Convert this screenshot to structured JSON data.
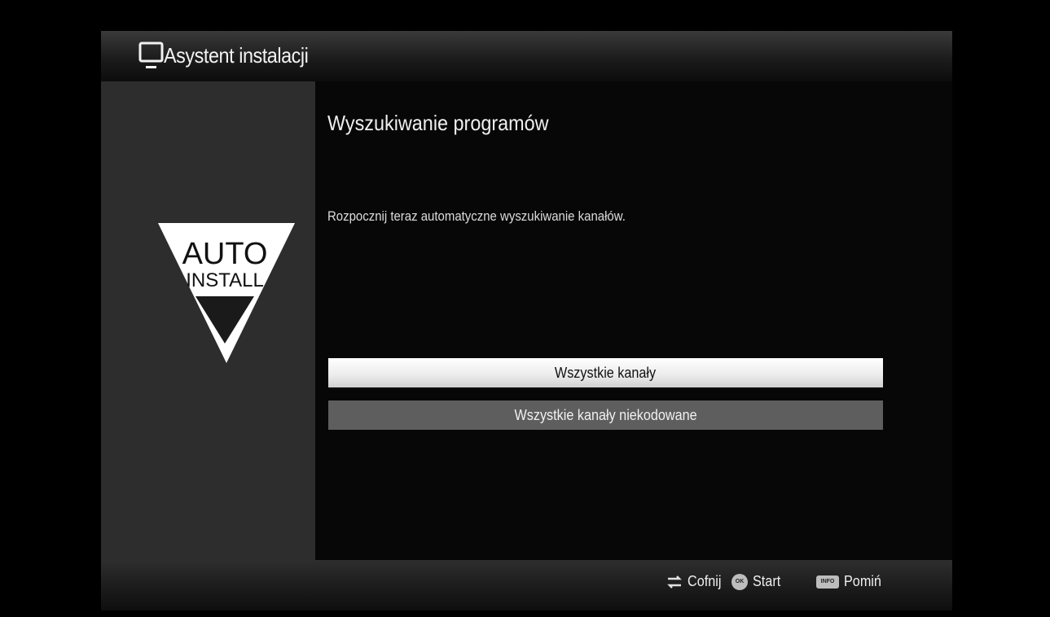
{
  "header": {
    "title": "Asystent instalacji",
    "icon": "tv-icon"
  },
  "sidebar": {
    "logo": {
      "icon": "auto-install-icon",
      "line1": "AUTO",
      "line2": "INSTALL"
    }
  },
  "main": {
    "title": "Wyszukiwanie programów",
    "description": "Rozpocznij teraz automatyczne wyszukiwanie kanałów.",
    "options": [
      {
        "label": "Wszystkie kanały",
        "selected": true
      },
      {
        "label": "Wszystkie kanały niekodowane",
        "selected": false
      }
    ]
  },
  "footer": {
    "hints": [
      {
        "key_icon": "back-arrows-icon",
        "label": "Cofnij"
      },
      {
        "key_icon": "ok-key-icon",
        "key_text": "OK",
        "label": "Start"
      },
      {
        "key_icon": "info-key-icon",
        "key_text": "INFO",
        "label": "Pomiń"
      }
    ]
  },
  "colors": {
    "header_bg": "#2a2a2a",
    "sidebar_bg": "#2d2d2d",
    "selected_option_bg": "#f2f2f2",
    "option_bg": "#5e5e5e",
    "text": "#efefef"
  }
}
